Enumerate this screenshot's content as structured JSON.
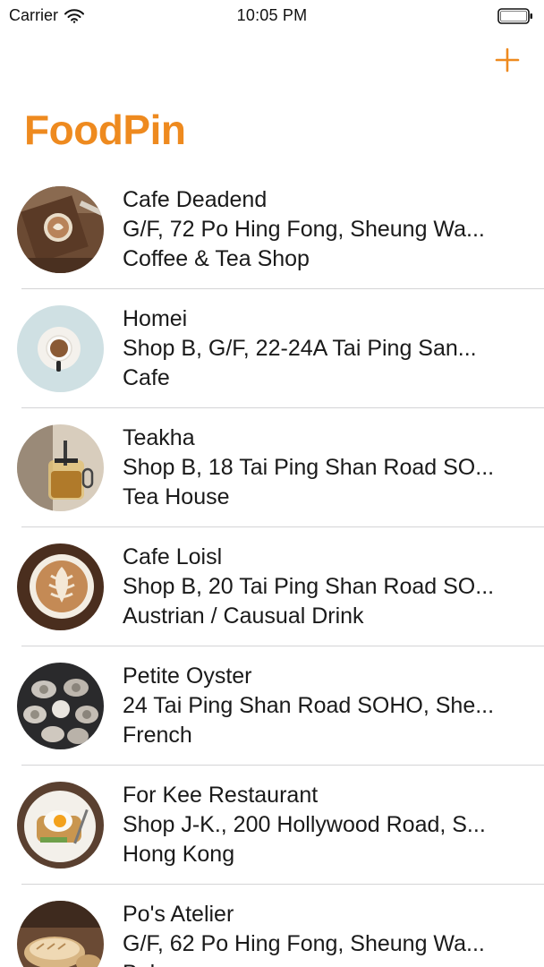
{
  "status": {
    "carrier": "Carrier",
    "time": "10:05 PM"
  },
  "nav": {
    "title": "FoodPin",
    "add_icon": "plus-icon",
    "accent": "#EE8A1F"
  },
  "restaurants": [
    {
      "name": "Cafe Deadend",
      "location": "G/F, 72 Po Hing Fong, Sheung Wa...",
      "type": "Coffee & Tea Shop"
    },
    {
      "name": "Homei",
      "location": "Shop B, G/F, 22-24A Tai Ping San...",
      "type": "Cafe"
    },
    {
      "name": "Teakha",
      "location": "Shop B, 18 Tai Ping Shan Road SO...",
      "type": "Tea House"
    },
    {
      "name": "Cafe Loisl",
      "location": "Shop B, 20 Tai Ping Shan Road SO...",
      "type": "Austrian / Causual Drink"
    },
    {
      "name": "Petite Oyster",
      "location": "24 Tai Ping Shan Road SOHO, She...",
      "type": "French"
    },
    {
      "name": "For Kee Restaurant",
      "location": "Shop J-K., 200 Hollywood Road, S...",
      "type": "Hong Kong"
    },
    {
      "name": "Po's Atelier",
      "location": "G/F, 62 Po Hing Fong, Sheung Wa...",
      "type": "Bakery"
    }
  ]
}
